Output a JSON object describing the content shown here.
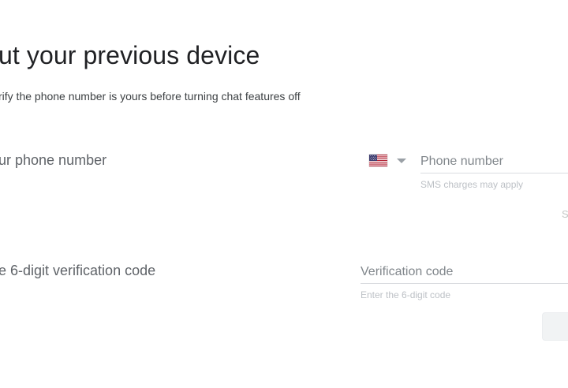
{
  "page": {
    "title": "ut your previous device",
    "subtitle": "rify the phone number is yours before turning chat features off"
  },
  "phone_step": {
    "label": "ur phone number",
    "country_icon": "us-flag-icon",
    "phone_placeholder": "Phone number",
    "phone_value": "",
    "hint": "SMS charges may apply",
    "send_link": "S"
  },
  "code_step": {
    "label": "e 6-digit verification code",
    "code_placeholder": "Verification code",
    "code_value": "",
    "hint": "Enter the 6-digit code"
  },
  "colors": {
    "title": "#202124",
    "muted": "#5f6368",
    "hint": "#bdc1c6",
    "divider": "#dadce0",
    "button_bg": "#f1f3f4"
  }
}
